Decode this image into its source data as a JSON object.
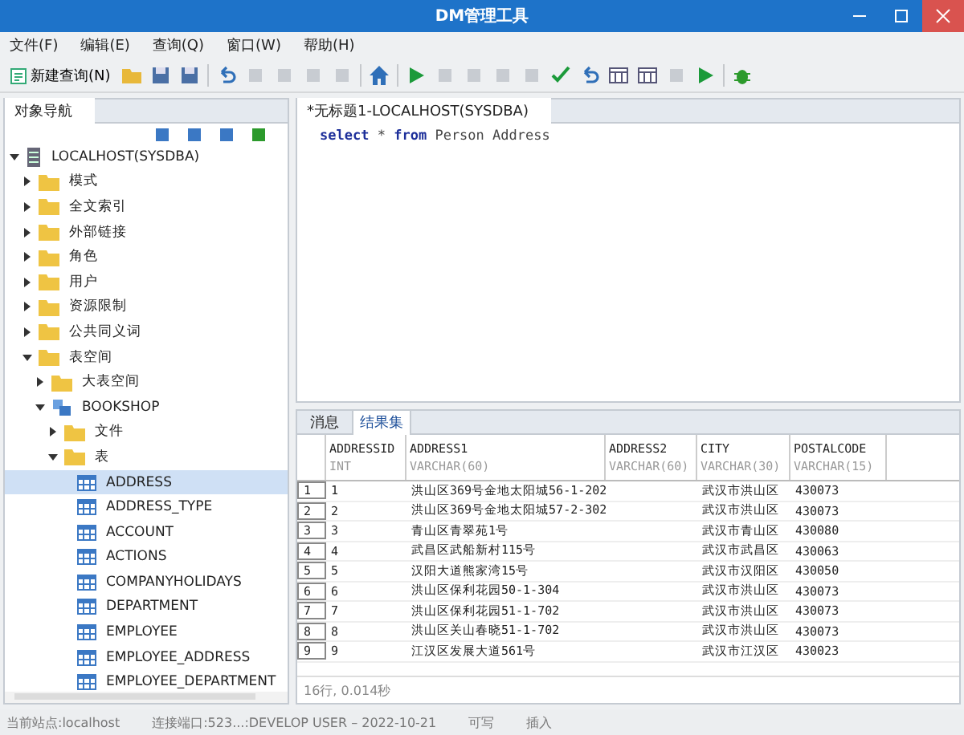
{
  "window": {
    "title": "DM管理工具"
  },
  "menu": [
    "文件(F)",
    "编辑(E)",
    "查询(Q)",
    "窗口(W)",
    "帮助(H)"
  ],
  "toolbar": {
    "new_query": "新建查询(N)"
  },
  "navigator": {
    "tab": "对象导航",
    "tree": [
      {
        "label": "LOCALHOST(SYSDBA)",
        "kind": "server",
        "expanded": true,
        "selected": false,
        "children": [
          {
            "label": "模式",
            "kind": "folder",
            "expanded": false,
            "selected": false
          },
          {
            "label": "全文索引",
            "kind": "folder",
            "expanded": false,
            "selected": false
          },
          {
            "label": "外部链接",
            "kind": "folder",
            "expanded": false,
            "selected": false
          },
          {
            "label": "角色",
            "kind": "folder",
            "expanded": false,
            "selected": false
          },
          {
            "label": "用户",
            "kind": "folder",
            "expanded": false,
            "selected": false
          },
          {
            "label": "资源限制",
            "kind": "folder",
            "expanded": false,
            "selected": false
          },
          {
            "label": "公共同义词",
            "kind": "folder",
            "expanded": false,
            "selected": false
          },
          {
            "label": "表空间",
            "kind": "folder",
            "expanded": true,
            "selected": false,
            "children": [
              {
                "label": "大表空间",
                "kind": "folder",
                "expanded": false,
                "selected": false
              },
              {
                "label": "BOOKSHOP",
                "kind": "schema",
                "expanded": true,
                "selected": false,
                "children": [
                  {
                    "label": "文件",
                    "kind": "folder",
                    "expanded": false,
                    "selected": false
                  },
                  {
                    "label": "表",
                    "kind": "folder",
                    "expanded": true,
                    "selected": false,
                    "children": [
                      {
                        "label": "ADDRESS",
                        "kind": "table",
                        "selected": true
                      },
                      {
                        "label": "ADDRESS_TYPE",
                        "kind": "table",
                        "selected": false
                      },
                      {
                        "label": "ACCOUNT",
                        "kind": "table",
                        "selected": false
                      },
                      {
                        "label": "ACTIONS",
                        "kind": "table",
                        "selected": false
                      },
                      {
                        "label": "COMPANYHOLIDAYS",
                        "kind": "table",
                        "selected": false
                      },
                      {
                        "label": "DEPARTMENT",
                        "kind": "table",
                        "selected": false
                      },
                      {
                        "label": "EMPLOYEE",
                        "kind": "table",
                        "selected": false
                      },
                      {
                        "label": "EMPLOYEE_ADDRESS",
                        "kind": "table",
                        "selected": false
                      },
                      {
                        "label": "EMPLOYEE_DEPARTMENT",
                        "kind": "table",
                        "selected": false
                      }
                    ]
                  }
                ]
              }
            ]
          }
        ]
      }
    ]
  },
  "editor": {
    "tab": "*无标题1-LOCALHOST(SYSDBA)",
    "sql": [
      {
        "text": "select",
        "kind": "keyword"
      },
      {
        "text": "*",
        "kind": "plain"
      },
      {
        "text": "from",
        "kind": "keyword"
      },
      {
        "text": "Person Address",
        "kind": "plain"
      }
    ]
  },
  "results": {
    "tabs": [
      {
        "label": "消息",
        "selected": false
      },
      {
        "label": "结果集",
        "selected": true
      }
    ],
    "columns": [
      {
        "name": "ADDRESSID",
        "type": "INT"
      },
      {
        "name": "ADDRESS1",
        "type": "VARCHAR(60)"
      },
      {
        "name": "ADDRESS2",
        "type": "VARCHAR(60)"
      },
      {
        "name": "CITY",
        "type": "VARCHAR(30)"
      },
      {
        "name": "POSTALCODE",
        "type": "VARCHAR(15)"
      }
    ],
    "rows": [
      {
        "num": "1",
        "cells": [
          "1",
          "洪山区369号金地太阳城56-1-202",
          "",
          "武汉市洪山区",
          "430073"
        ]
      },
      {
        "num": "2",
        "cells": [
          "2",
          "洪山区369号金地太阳城57-2-302",
          "",
          "武汉市洪山区",
          "430073"
        ]
      },
      {
        "num": "3",
        "cells": [
          "3",
          "青山区青翠苑1号",
          "",
          "武汉市青山区",
          "430080"
        ]
      },
      {
        "num": "4",
        "cells": [
          "4",
          "武昌区武船新村115号",
          "",
          "武汉市武昌区",
          "430063"
        ]
      },
      {
        "num": "5",
        "cells": [
          "5",
          "汉阳大道熊家湾15号",
          "",
          "武汉市汉阳区",
          "430050"
        ]
      },
      {
        "num": "6",
        "cells": [
          "6",
          "洪山区保利花园50-1-304",
          "",
          "武汉市洪山区",
          "430073"
        ]
      },
      {
        "num": "7",
        "cells": [
          "7",
          "洪山区保利花园51-1-702",
          "",
          "武汉市洪山区",
          "430073"
        ]
      },
      {
        "num": "8",
        "cells": [
          "8",
          "洪山区关山春晓51-1-702",
          "",
          "武汉市洪山区",
          "430073"
        ]
      },
      {
        "num": "9",
        "cells": [
          "9",
          "江汉区发展大道561号",
          "",
          "武汉市江汉区",
          "430023"
        ]
      }
    ],
    "summary": "16行, 0.014秒"
  },
  "status_bar": [
    "当前站点:localhost",
    "连接端口:523...:DEVELOP USER – 2022-10-21",
    "可写",
    "插入"
  ]
}
